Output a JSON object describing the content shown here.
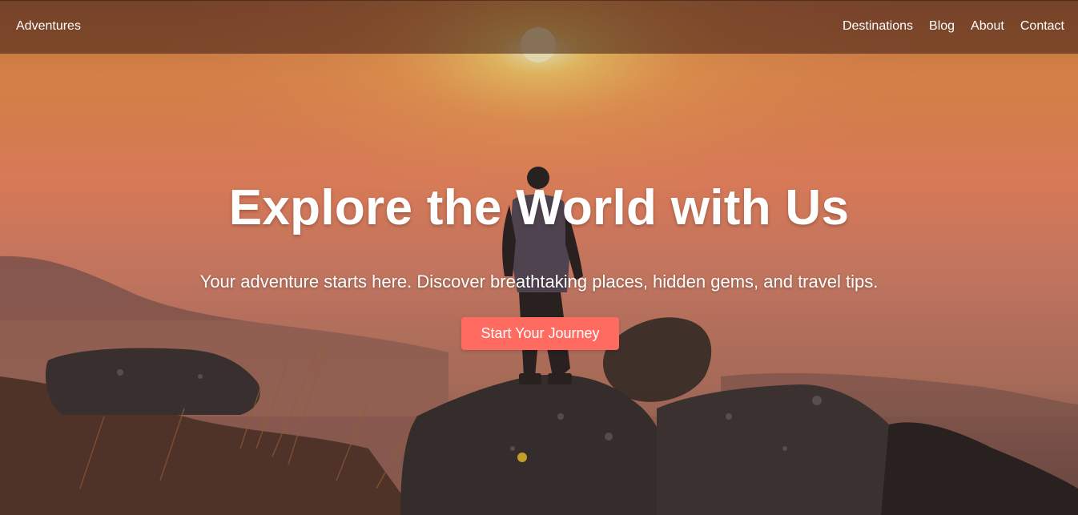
{
  "navbar": {
    "brand": "Adventures",
    "links": [
      {
        "label": "Destinations"
      },
      {
        "label": "Blog"
      },
      {
        "label": "About"
      },
      {
        "label": "Contact"
      }
    ]
  },
  "hero": {
    "title": "Explore the World with Us",
    "subtitle": "Your adventure starts here. Discover breathtaking places, hidden gems, and travel tips.",
    "cta_label": "Start Your Journey"
  },
  "colors": {
    "cta_background": "#ff6b61",
    "sky_top": "#e08a4f",
    "sky_mid": "#f0835f",
    "nav_overlay": "rgba(60,30,20,0.55)"
  }
}
